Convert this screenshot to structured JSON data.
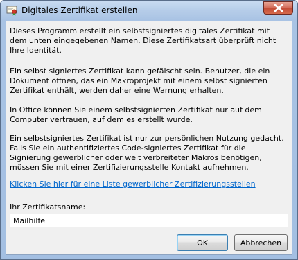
{
  "window": {
    "title": "Digitales Zertifikat erstellen",
    "close_icon": "close-icon",
    "app_icon": "certificate-icon"
  },
  "body": {
    "paragraphs": [
      "Dieses Programm erstellt ein selbstsigniertes digitales Zertifikat mit dem unten eingegebenen Namen. Diese Zertifikatsart überprüft nicht Ihre Identität.",
      "Ein selbst signiertes Zertifikat kann gefälscht sein. Benutzer, die ein Dokument öffnen, das ein Makroprojekt mit einem selbst signierten Zertifikat enthält, werden daher eine Warnung erhalten.",
      "In Office können Sie einem selbstsignierten Zertifikat nur auf dem Computer vertrauen, auf dem es erstellt wurde.",
      "Ein selbstsigniertes Zertifikat ist nur zur persönlichen Nutzung gedacht. Falls Sie ein authentifiziertes Code-signiertes Zertifikat für die Signierung gewerblicher oder weit verbreiteter Makros benötigen, müssen Sie mit einer Zertifizierungsstelle Kontakt aufnehmen."
    ],
    "link": "Klicken Sie hier für eine Liste gewerblicher Zertifizierungsstellen",
    "name_label": "Ihr Zertifikatsname:",
    "name_value": "Mailhilfe"
  },
  "buttons": {
    "ok": "OK",
    "cancel": "Abbrechen"
  },
  "colors": {
    "link": "#0066cc",
    "client_bg": "#f0f0f0",
    "close_button": "#c24a36"
  }
}
